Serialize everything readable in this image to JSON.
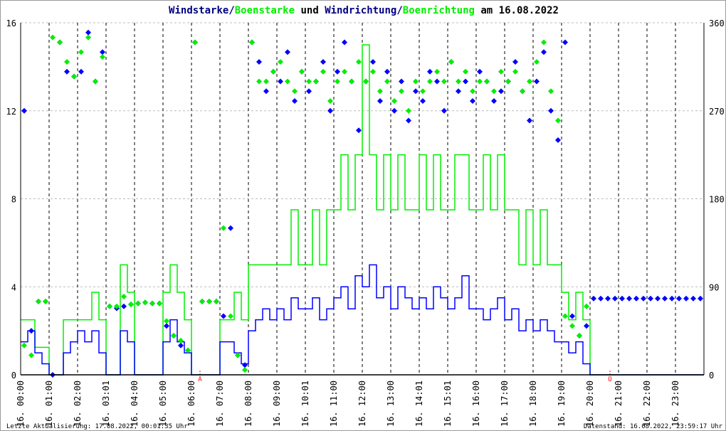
{
  "chart_data": {
    "type": "line",
    "title_parts": [
      {
        "text": "Windstarke/",
        "color": "#000080"
      },
      {
        "text": "Boenstarke",
        "color": "#00ee00"
      },
      {
        "text": " und ",
        "color": "#000000"
      },
      {
        "text": "Windrichtung/",
        "color": "#000080"
      },
      {
        "text": "Boenrichtung",
        "color": "#00ee00"
      },
      {
        "text": " am 16.08.2022",
        "color": "#000000"
      }
    ],
    "x_tick_labels": [
      "16. 00:00",
      "16. 01:00",
      "16. 02:00",
      "16. 03:01",
      "16. 04:00",
      "16. 05:00",
      "16. 06:00",
      "16. 07:00",
      "16. 08:00",
      "16. 09:00",
      "16. 10:01",
      "16. 11:00",
      "16. 12:00",
      "16. 13:00",
      "16. 14:01",
      "16. 15:01",
      "16. 16:00",
      "16. 17:00",
      "16. 18:00",
      "16. 19:00",
      "16. 20:00",
      "16. 21:00",
      "16. 22:00",
      "16. 23:00"
    ],
    "xlim_hours": [
      0,
      24
    ],
    "sample_interval_minutes": 15,
    "left_axis": {
      "ylim": [
        0,
        16
      ],
      "ticks": [
        "0",
        "4",
        "8",
        "12",
        "16"
      ]
    },
    "right_axis": {
      "ylim": [
        0,
        360
      ],
      "ticks": [
        "0",
        "90",
        "180",
        "270",
        "360"
      ]
    },
    "markers": [
      {
        "label": "A",
        "hour": 6.3,
        "color": "#ff0000"
      },
      {
        "label": "U",
        "hour": 20.7,
        "color": "#ff0000"
      }
    ],
    "series": [
      {
        "name": "Windstarke",
        "color": "#0000ff",
        "axis": "left",
        "style": "step",
        "values": [
          1.5,
          2,
          1,
          0.5,
          0,
          0,
          1,
          1.5,
          2,
          1.5,
          2,
          1,
          0,
          0,
          2,
          1.5,
          0,
          0,
          0,
          0,
          1.5,
          2.5,
          1.5,
          1,
          0,
          0,
          0,
          0,
          1.5,
          1.5,
          1,
          0.5,
          2,
          2.5,
          3,
          2.5,
          3,
          2.5,
          3.5,
          3,
          3,
          3.5,
          2.5,
          3,
          3.5,
          4,
          3,
          4.5,
          4,
          5,
          3.5,
          4,
          3,
          4,
          3.5,
          3,
          3.5,
          3,
          4,
          3.5,
          3,
          3.5,
          4.5,
          3,
          3,
          2.5,
          3,
          3.5,
          2.5,
          3,
          2,
          2.5,
          2,
          2.5,
          2,
          1.5,
          1.5,
          1,
          1.5,
          0.5,
          0,
          0,
          0,
          0,
          0,
          0,
          0,
          0,
          0,
          0,
          0,
          0,
          0,
          0,
          0,
          0
        ]
      },
      {
        "name": "Boenstarke",
        "color": "#00ee00",
        "axis": "left",
        "style": "step",
        "values": [
          2.5,
          2.5,
          1.25,
          1.25,
          0,
          0,
          2.5,
          2.5,
          2.5,
          2.5,
          3.75,
          2.5,
          0,
          0,
          5,
          3.75,
          0,
          0,
          0,
          0,
          3.75,
          5,
          3.75,
          2.5,
          0,
          0,
          0,
          0,
          2.5,
          2.5,
          3.75,
          2.5,
          5,
          5,
          5,
          5,
          5,
          5,
          7.5,
          5,
          5,
          7.5,
          5,
          7.5,
          7.5,
          10,
          7.5,
          10,
          15,
          10,
          7.5,
          10,
          7.5,
          10,
          7.5,
          7.5,
          10,
          7.5,
          10,
          7.5,
          7.5,
          10,
          10,
          7.5,
          7.5,
          10,
          7.5,
          10,
          7.5,
          7.5,
          5,
          7.5,
          5,
          7.5,
          5,
          5,
          3.75,
          2.5,
          3.75,
          2.5,
          0,
          0,
          0,
          0,
          0,
          0,
          0,
          0,
          0,
          0,
          0,
          0,
          0,
          0,
          0,
          0
        ]
      },
      {
        "name": "Windrichtung",
        "color": "#0000ff",
        "axis": "right",
        "style": "diamond",
        "values": [
          270,
          45,
          75,
          75,
          0,
          340,
          310,
          305,
          310,
          350,
          300,
          330,
          70,
          68,
          70,
          72,
          73,
          74,
          73,
          73,
          50,
          40,
          30,
          25,
          340,
          75,
          75,
          75,
          60,
          150,
          20,
          10,
          340,
          320,
          290,
          310,
          300,
          330,
          280,
          310,
          290,
          300,
          320,
          270,
          310,
          340,
          300,
          250,
          300,
          320,
          280,
          310,
          270,
          300,
          260,
          290,
          280,
          310,
          300,
          270,
          320,
          290,
          300,
          280,
          310,
          300,
          280,
          290,
          300,
          320,
          290,
          260,
          300,
          330,
          270,
          240,
          340,
          60,
          40,
          50,
          78,
          78,
          78,
          78,
          78,
          78,
          78,
          78,
          78,
          78,
          78,
          78,
          78,
          78,
          78,
          78
        ]
      },
      {
        "name": "Boenrichtung",
        "color": "#00ee00",
        "axis": "right",
        "style": "diamond",
        "values": [
          30,
          20,
          75,
          75,
          345,
          340,
          320,
          305,
          330,
          345,
          300,
          325,
          70,
          70,
          80,
          72,
          73,
          74,
          73,
          73,
          55,
          40,
          35,
          25,
          340,
          75,
          75,
          75,
          150,
          60,
          20,
          5,
          340,
          300,
          300,
          310,
          320,
          300,
          290,
          310,
          300,
          300,
          310,
          280,
          300,
          310,
          300,
          320,
          300,
          310,
          290,
          300,
          280,
          290,
          270,
          300,
          290,
          300,
          310,
          300,
          320,
          300,
          310,
          290,
          300,
          300,
          290,
          310,
          300,
          310,
          290,
          300,
          320,
          340,
          290,
          260,
          60,
          50,
          40,
          70,
          null,
          null,
          null,
          null,
          null,
          null,
          null,
          null,
          null,
          null,
          null,
          null,
          null,
          null,
          null,
          null
        ]
      }
    ]
  },
  "footer": {
    "last_update": "Letzte Aktualisierung: 17.08.2022, 00:01:35 Uhr",
    "data_state": "Datenstand: 16.08.2022, 23:59:17 Uhr"
  }
}
